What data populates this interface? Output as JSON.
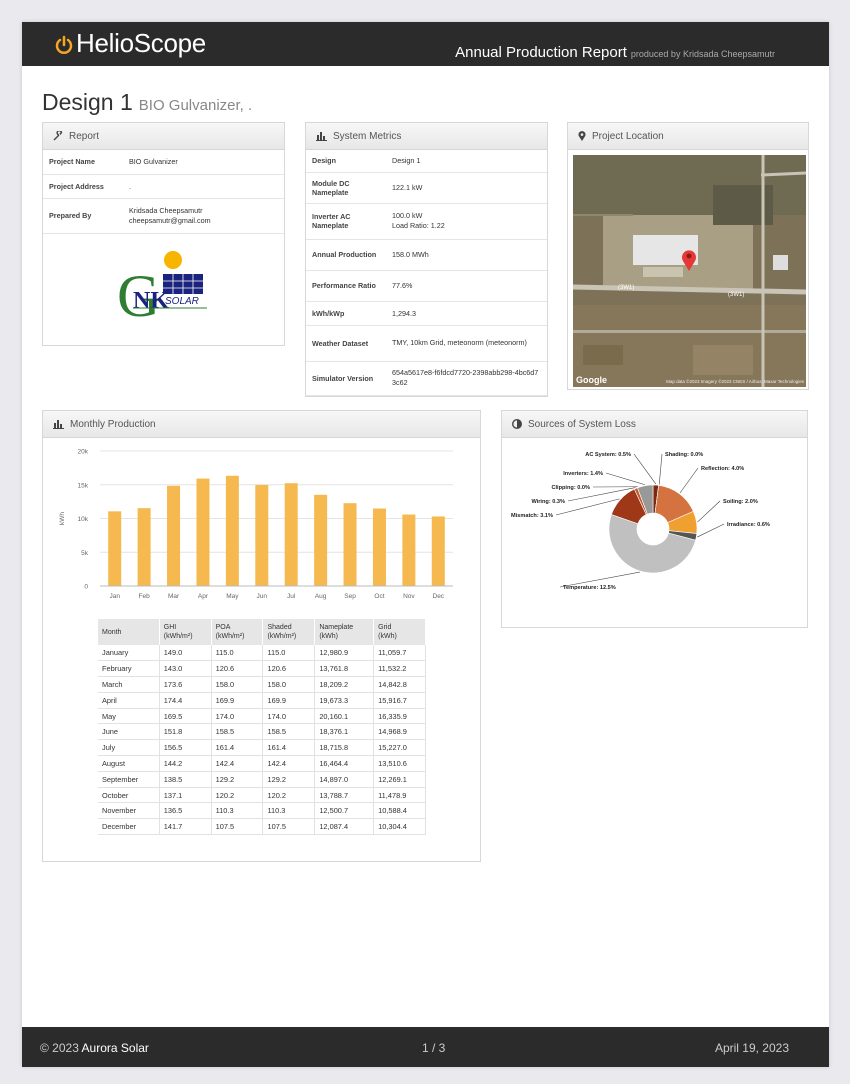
{
  "header": {
    "brand": "HelioScope",
    "report_title": "Annual Production Report",
    "produced_by": "produced by Kridsada Cheepsamutr"
  },
  "design": {
    "title": "Design 1",
    "subtitle": "BIO Gulvanizer,      ."
  },
  "report_panel": {
    "heading": "Report",
    "rows": [
      {
        "label": "Project Name",
        "value": "BIO Gulvanizer"
      },
      {
        "label": "Project Address",
        "value": "."
      },
      {
        "label": "Prepared By",
        "value": "Kridsada Cheepsamutr\ncheepsamutr@gmail.com"
      }
    ],
    "logo_text": "SOLAR",
    "logo_letters": "NK",
    "logo_g": "G"
  },
  "metrics_panel": {
    "heading": "System Metrics",
    "rows": [
      {
        "label": "Design",
        "value": "Design 1"
      },
      {
        "label": "Module DC Nameplate",
        "value": "122.1 kW"
      },
      {
        "label": "Inverter AC Nameplate",
        "value": "100.0 kW\nLoad Ratio: 1.22"
      },
      {
        "label": "Annual Production",
        "value": "158.0 MWh"
      },
      {
        "label": "Performance Ratio",
        "value": "77.6%"
      },
      {
        "label": "kWh/kWp",
        "value": "1,294.3"
      },
      {
        "label": "Weather Dataset",
        "value": "TMY, 10km Grid, meteonorm (meteonorm)"
      },
      {
        "label": "Simulator Version",
        "value": "654a5617e8-f6fdcd7720-2398abb298-4bc6d73c62"
      }
    ]
  },
  "location_panel": {
    "heading": "Project Location",
    "map_brand": "Google",
    "map_credit": "Map data ©2023 Imagery ©2023 CNES / Airbus, Maxar Technologies",
    "road_label": "(3W1)"
  },
  "monthly_panel": {
    "heading": "Monthly Production",
    "table": {
      "headers": [
        "Month",
        "GHI\n(kWh/m²)",
        "POA\n(kWh/m²)",
        "Shaded\n(kWh/m²)",
        "Nameplate\n(kWh)",
        "Grid\n(kWh)"
      ],
      "rows": [
        [
          "January",
          "149.0",
          "115.0",
          "115.0",
          "12,980.9",
          "11,059.7"
        ],
        [
          "February",
          "143.0",
          "120.6",
          "120.6",
          "13,761.8",
          "11,532.2"
        ],
        [
          "March",
          "173.6",
          "158.0",
          "158.0",
          "18,209.2",
          "14,842.8"
        ],
        [
          "April",
          "174.4",
          "169.9",
          "169.9",
          "19,673.3",
          "15,916.7"
        ],
        [
          "May",
          "169.5",
          "174.0",
          "174.0",
          "20,160.1",
          "16,335.9"
        ],
        [
          "June",
          "151.8",
          "158.5",
          "158.5",
          "18,376.1",
          "14,968.9"
        ],
        [
          "July",
          "156.5",
          "161.4",
          "161.4",
          "18,715.8",
          "15,227.0"
        ],
        [
          "August",
          "144.2",
          "142.4",
          "142.4",
          "16,464.4",
          "13,510.6"
        ],
        [
          "September",
          "138.5",
          "129.2",
          "129.2",
          "14,897.0",
          "12,269.1"
        ],
        [
          "October",
          "137.1",
          "120.2",
          "120.2",
          "13,788.7",
          "11,478.9"
        ],
        [
          "November",
          "136.5",
          "110.3",
          "110.3",
          "12,500.7",
          "10,588.4"
        ],
        [
          "December",
          "141.7",
          "107.5",
          "107.5",
          "12,087.4",
          "10,304.4"
        ]
      ]
    }
  },
  "loss_panel": {
    "heading": "Sources of System Loss"
  },
  "chart_data": [
    {
      "type": "bar",
      "categories": [
        "Jan",
        "Feb",
        "Mar",
        "Apr",
        "May",
        "Jun",
        "Jul",
        "Aug",
        "Sep",
        "Oct",
        "Nov",
        "Dec"
      ],
      "values": [
        11059.7,
        11532.2,
        14842.8,
        15916.7,
        16335.9,
        14968.9,
        15227.0,
        13510.6,
        12269.1,
        11478.9,
        10588.4,
        10304.4
      ],
      "ylabel": "kWh",
      "ylim": [
        0,
        20000
      ],
      "yticks": [
        "0",
        "5k",
        "10k",
        "15k",
        "20k"
      ],
      "grid": true,
      "color": "#f5b950"
    },
    {
      "type": "pie",
      "labels": [
        "AC System: 0.5%",
        "Shading: 0.0%",
        "Reflection: 4.0%",
        "Soiling: 2.0%",
        "Irradiance: 0.6%",
        "Temperature: 12.5%",
        "Mismatch: 3.1%",
        "Wiring: 0.3%",
        "Clipping: 0.0%",
        "Inverters: 1.4%"
      ],
      "values": [
        0.5,
        0.0,
        4.0,
        2.0,
        0.6,
        12.5,
        3.1,
        0.3,
        0.0,
        1.4
      ],
      "colors": [
        "#7a2a12",
        "#a33a1a",
        "#d4733f",
        "#f0a030",
        "#555555",
        "#c0c0c0",
        "#9e3818",
        "#c25a30",
        "#dd8850",
        "#999999"
      ],
      "donut": true
    }
  ],
  "footer": {
    "copyright": "© 2023",
    "company": "Aurora Solar",
    "page": "1 / 3",
    "date": "April 19, 2023"
  }
}
